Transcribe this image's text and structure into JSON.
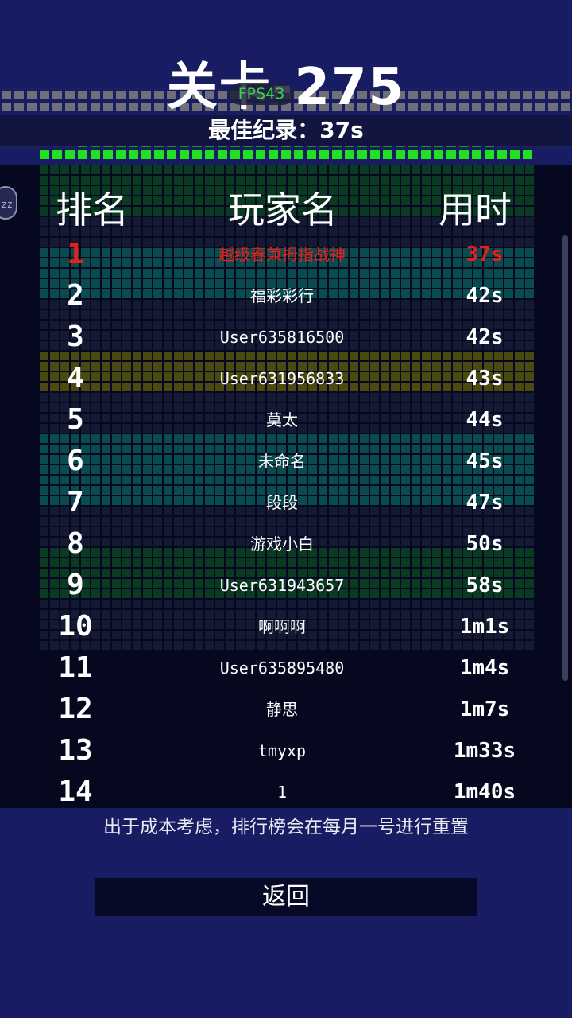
{
  "level_title": "关卡-275",
  "fps_label": "FPS43",
  "best_record": "最佳纪录：37s",
  "headers": {
    "rank": "排名",
    "player": "玩家名",
    "time": "用时"
  },
  "avatar_text": "zz",
  "rows": [
    {
      "rank": "1",
      "name": "越级春兼拇指战神",
      "time": "37s"
    },
    {
      "rank": "2",
      "name": "福彩彩行",
      "time": "42s"
    },
    {
      "rank": "3",
      "name": "User635816500",
      "time": "42s"
    },
    {
      "rank": "4",
      "name": "User631956833",
      "time": "43s"
    },
    {
      "rank": "5",
      "name": "莫太",
      "time": "44s"
    },
    {
      "rank": "6",
      "name": "未命名",
      "time": "45s"
    },
    {
      "rank": "7",
      "name": "段段",
      "time": "47s"
    },
    {
      "rank": "8",
      "name": "游戏小白",
      "time": "50s"
    },
    {
      "rank": "9",
      "name": "User631943657",
      "time": "58s"
    },
    {
      "rank": "10",
      "name": "啊啊啊",
      "time": "1m1s"
    },
    {
      "rank": "11",
      "name": "User635895480",
      "time": "1m4s"
    },
    {
      "rank": "12",
      "name": "静思",
      "time": "1m7s"
    },
    {
      "rank": "13",
      "name": "tmyxp",
      "time": "1m33s"
    },
    {
      "rank": "14",
      "name": "1",
      "time": "1m40s"
    }
  ],
  "note": "出于成本考虑，排行榜会在每月一号进行重置",
  "back_label": "返回",
  "colors": {
    "background": "#181c62",
    "board": "#05081f",
    "first_place": "#e5201b",
    "fps": "#3bd14a"
  }
}
